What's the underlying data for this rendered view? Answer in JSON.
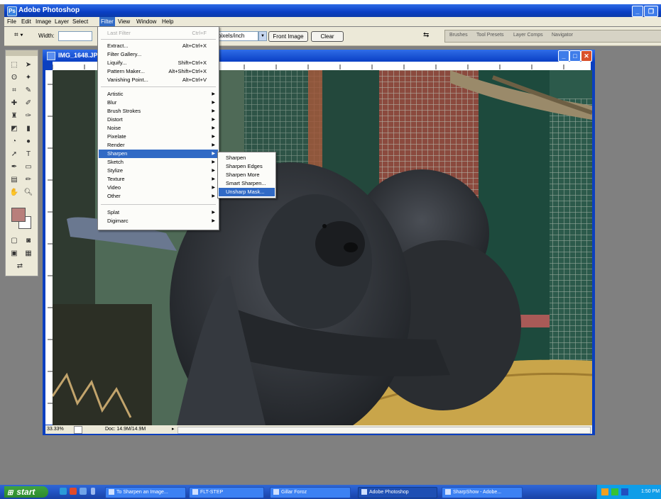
{
  "app": {
    "title": "Adobe Photoshop"
  },
  "menubar": {
    "items": [
      "File",
      "Edit",
      "Image",
      "Layer",
      "Select",
      "Filter",
      "View",
      "Window",
      "Help"
    ]
  },
  "options_bar": {
    "width_label": "Width:",
    "resolution_value": "pixels/inch",
    "front_image_label": "Front Image",
    "clear_label": "Clear",
    "palette_tabs": [
      "Brushes",
      "Tool Presets",
      "Layer Comps",
      "Navigator"
    ]
  },
  "document": {
    "title": "IMG_1648.JPG",
    "zoom": "33.33%",
    "doc_size": "Doc: 14.9M/14.9M"
  },
  "filter_menu": {
    "last_filter": {
      "label": "Last Filter",
      "shortcut": "Ctrl+F"
    },
    "group1": [
      {
        "label": "Extract...",
        "shortcut": "Alt+Ctrl+X"
      },
      {
        "label": "Filter Gallery...",
        "shortcut": ""
      },
      {
        "label": "Liquify...",
        "shortcut": "Shift+Ctrl+X"
      },
      {
        "label": "Pattern Maker...",
        "shortcut": "Alt+Shift+Ctrl+X"
      },
      {
        "label": "Vanishing Point...",
        "shortcut": "Alt+Ctrl+V"
      }
    ],
    "group2": [
      "Artistic",
      "Blur",
      "Brush Strokes",
      "Distort",
      "Noise",
      "Pixelate",
      "Render",
      "Sharpen",
      "Sketch",
      "Stylize",
      "Texture",
      "Video",
      "Other"
    ],
    "group3": [
      "Digimarc"
    ],
    "group3_first": "Splat",
    "highlighted": "Sharpen"
  },
  "sharpen_submenu": {
    "items": [
      "Sharpen",
      "Sharpen Edges",
      "Sharpen More",
      "Smart Sharpen...",
      "Unsharp Mask..."
    ],
    "highlighted": "Unsharp Mask..."
  },
  "taskbar": {
    "start_label": "start",
    "tasks": [
      "To Sharpen an Image...",
      "FLT-STEP",
      "Gillar Foroz",
      "Adobe Photoshop",
      "SharpShow - Adobe..."
    ],
    "clock": "1:50 PM"
  },
  "colors": {
    "xp_blue": "#0a3fc4",
    "highlight": "#316ac5",
    "foreground_swatch": "#b87f7b"
  }
}
